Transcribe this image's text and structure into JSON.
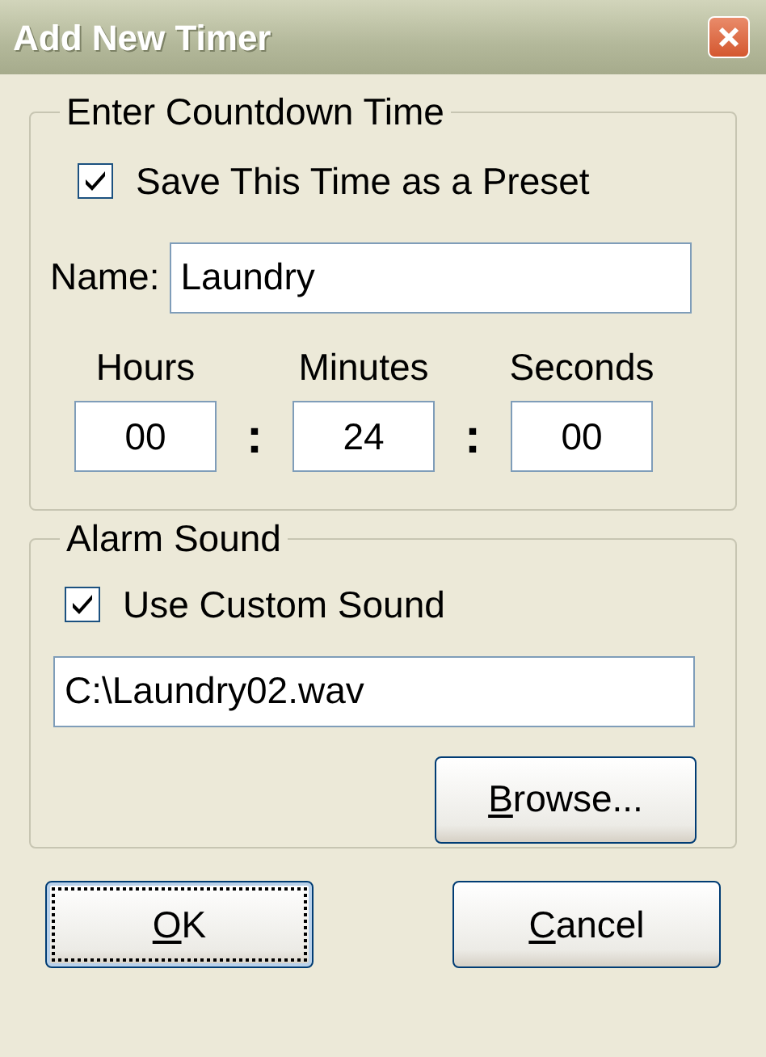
{
  "window": {
    "title": "Add New Timer"
  },
  "countdown_group": {
    "legend": "Enter Countdown Time",
    "save_preset": {
      "label": "Save This Time as a Preset",
      "checked": true
    },
    "name_field": {
      "label": "Name:",
      "value": "Laundry"
    },
    "time_fields": [
      {
        "label": "Hours",
        "value": "00"
      },
      {
        "label": "Minutes",
        "value": "24"
      },
      {
        "label": "Seconds",
        "value": "00"
      }
    ],
    "separators": [
      ":",
      ":"
    ]
  },
  "alarm_group": {
    "legend": "Alarm Sound",
    "custom_sound": {
      "label": "Use Custom Sound",
      "checked": true
    },
    "sound_path": {
      "value": "C:\\Laundry02.wav"
    },
    "browse_button": {
      "label": "Browse...",
      "underline_first": true
    }
  },
  "buttons": [
    {
      "label": "OK",
      "underline_first": true,
      "focused": true
    },
    {
      "label": "Cancel",
      "underline_first": true,
      "focused": false
    }
  ]
}
